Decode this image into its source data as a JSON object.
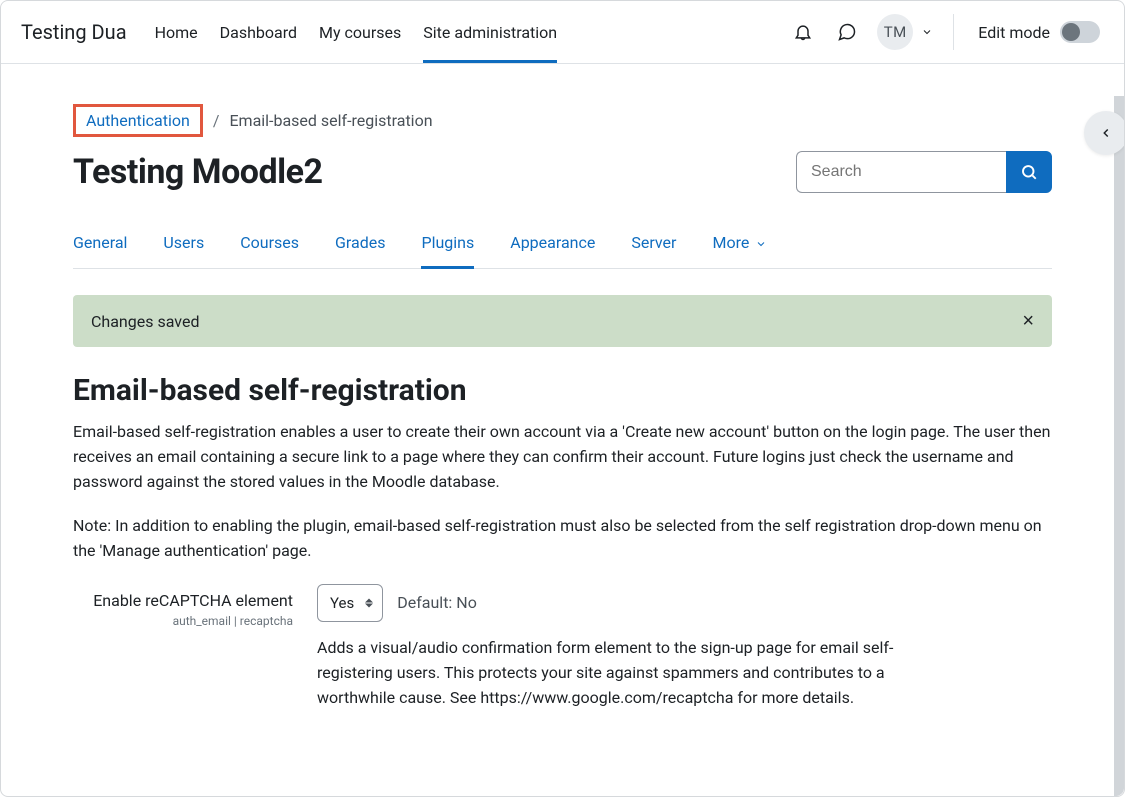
{
  "brand": "Testing Dua",
  "primary_nav": {
    "home": "Home",
    "dashboard": "Dashboard",
    "my_courses": "My courses",
    "site_admin": "Site administration"
  },
  "user": {
    "initials": "TM"
  },
  "edit_mode_label": "Edit mode",
  "breadcrumb": {
    "parent": "Authentication",
    "current": "Email-based self-registration"
  },
  "page_title": "Testing Moodle2",
  "search": {
    "placeholder": "Search"
  },
  "tabs": {
    "general": "General",
    "users": "Users",
    "courses": "Courses",
    "grades": "Grades",
    "plugins": "Plugins",
    "appearance": "Appearance",
    "server": "Server",
    "more": "More"
  },
  "alert": {
    "text": "Changes saved"
  },
  "section": {
    "title": "Email-based self-registration",
    "desc1": "Email-based self-registration enables a user to create their own account via a 'Create new account' button on the login page. The user then receives an email containing a secure link to a page where they can confirm their account. Future logins just check the username and password against the stored values in the Moodle database.",
    "desc2": "Note: In addition to enabling the plugin, email-based self-registration must also be selected from the self registration drop-down menu on the 'Manage authentication' page."
  },
  "setting": {
    "label": "Enable reCAPTCHA element",
    "key": "auth_email | recaptcha",
    "value": "Yes",
    "default_label": "Default: No",
    "help": "Adds a visual/audio confirmation form element to the sign-up page for email self-registering users. This protects your site against spammers and contributes to a worthwhile cause. See https://www.google.com/recaptcha for more details."
  }
}
